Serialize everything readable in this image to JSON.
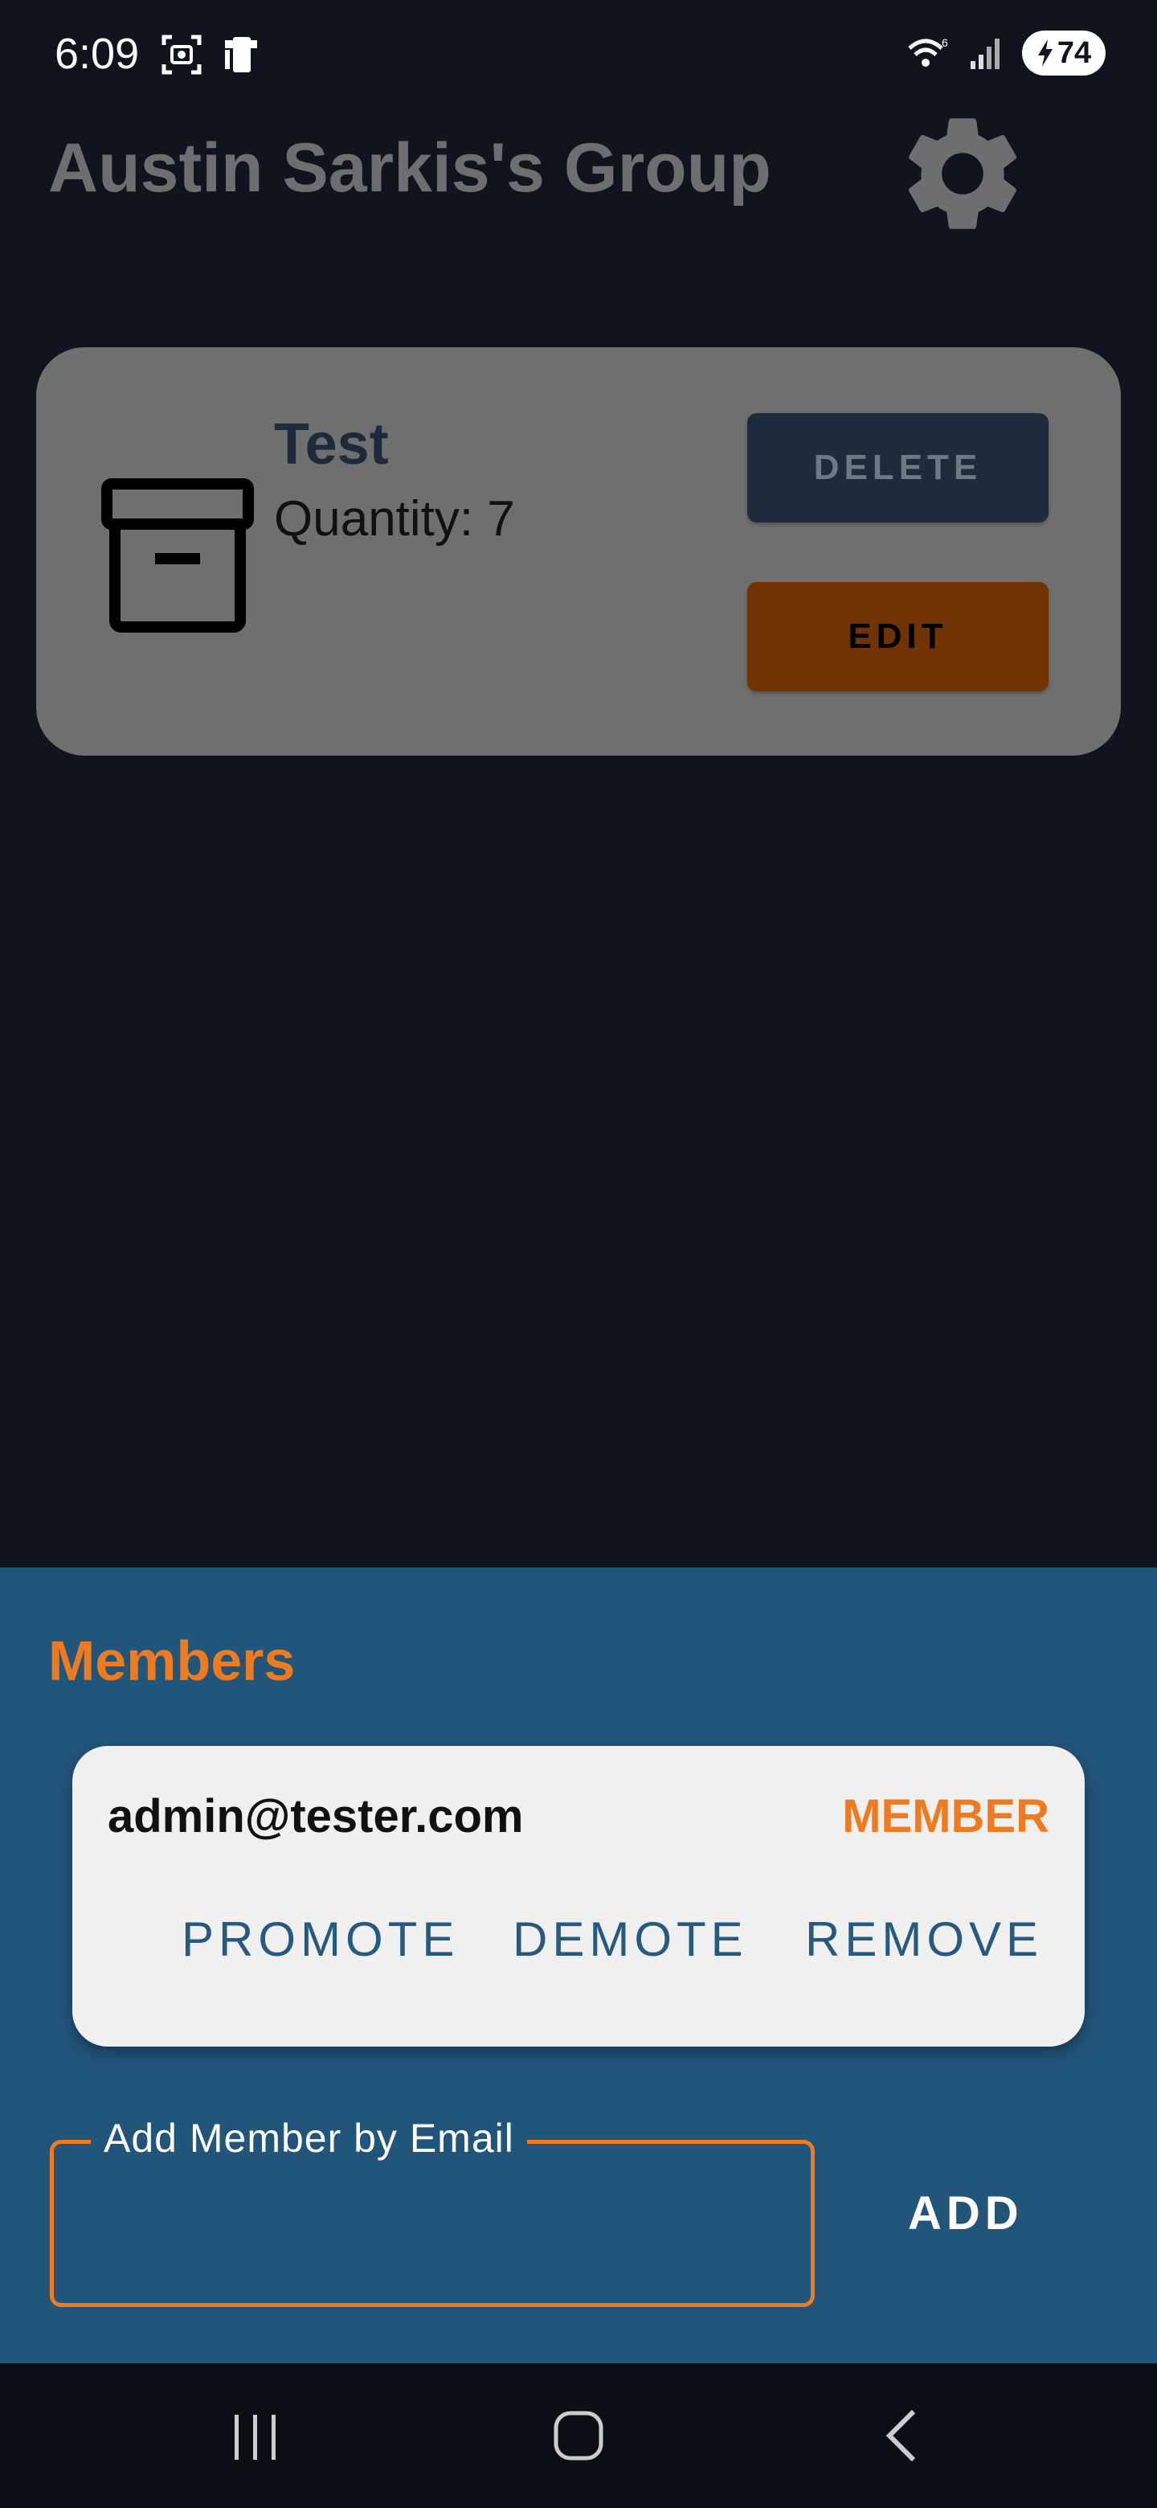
{
  "status_bar": {
    "time": "6:09",
    "battery": "74",
    "icons": [
      "screenshot-icon",
      "phone-icon",
      "wifi-icon",
      "signal-icon",
      "battery-icon"
    ]
  },
  "header": {
    "title": "Austin Sarkis's Group",
    "settings_icon": "gear-icon"
  },
  "item": {
    "icon": "archive-box-icon",
    "name": "Test",
    "quantity": "Quantity: 7",
    "delete_label": "DELETE",
    "edit_label": "EDIT"
  },
  "members": {
    "title": "Members",
    "list": [
      {
        "email": "admin@tester.com",
        "role": "MEMBER",
        "promote_label": "PROMOTE",
        "demote_label": "DEMOTE",
        "remove_label": "REMOVE"
      }
    ],
    "add_field": {
      "label": "Add Member by Email",
      "value": ""
    },
    "add_label": "ADD"
  },
  "nav_bar": {
    "icons": [
      "recents-icon",
      "home-icon",
      "back-icon"
    ]
  },
  "colors": {
    "background": "#10141e",
    "panel": "#22557a",
    "accent": "#f07a20",
    "card": "#6f6f6f",
    "delete_button": "#1e2b3a",
    "edit_button": "#703301"
  }
}
